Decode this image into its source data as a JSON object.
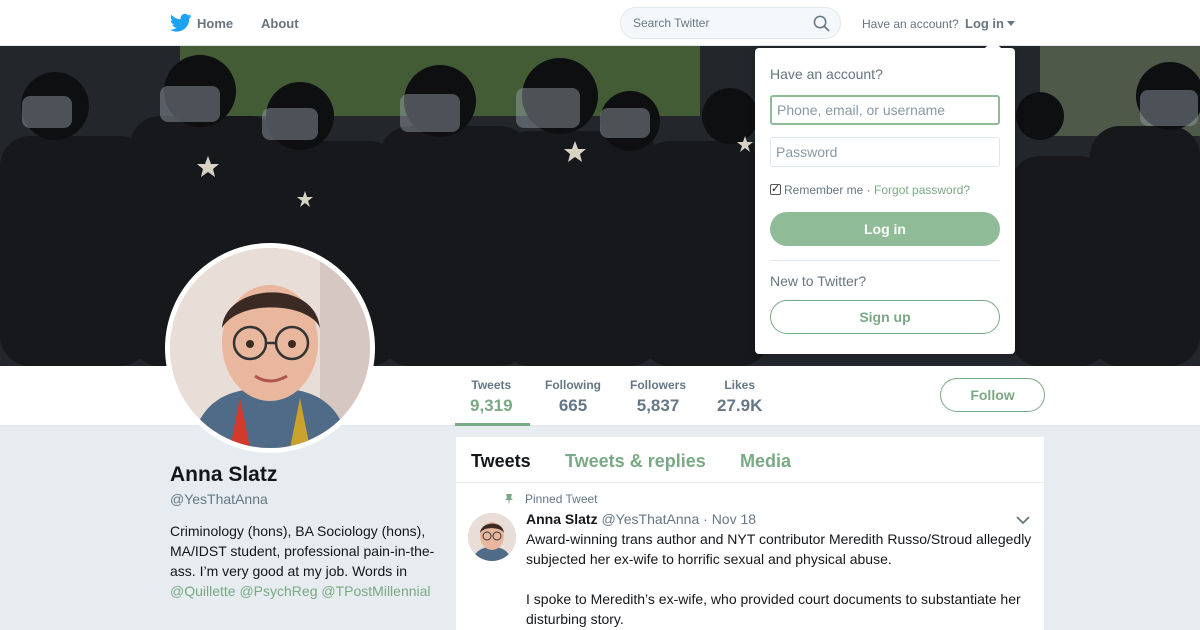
{
  "nav": {
    "home_label": "Home",
    "about_label": "About",
    "search_placeholder": "Search Twitter",
    "have_account": "Have an account?",
    "login_label": "Log in"
  },
  "profile": {
    "name": "Anna Slatz",
    "handle": "@YesThatAnna",
    "bio_text": "Criminology (hons), BA Sociology (hons), MA/IDST student, professional pain-in-the-ass. I’m very good at my job. Words in ",
    "bio_links": [
      "@Quillette",
      "@PsychReg",
      "@TPostMillennial"
    ],
    "follow_label": "Follow"
  },
  "stats": [
    {
      "label": "Tweets",
      "value": "9,319",
      "active": true
    },
    {
      "label": "Following",
      "value": "665"
    },
    {
      "label": "Followers",
      "value": "5,837"
    },
    {
      "label": "Likes",
      "value": "27.9K"
    }
  ],
  "timeline": {
    "tabs": [
      "Tweets",
      "Tweets & replies",
      "Media"
    ],
    "pinned_label": "Pinned Tweet",
    "tweet": {
      "name": "Anna Slatz",
      "handle": "@YesThatAnna",
      "date": "Nov 18",
      "text": "Award-winning trans author and NYT contributor Meredith Russo/Stroud allegedly subjected her ex-wife to horrific sexual and physical abuse.\n\nI spoke to Meredith’s ex-wife, who provided court documents to substantiate her disturbing story."
    }
  },
  "login_dropdown": {
    "title": "Have an account?",
    "username_placeholder": "Phone, email, or username",
    "password_placeholder": "Password",
    "remember_me": "Remember me",
    "separator": " · ",
    "forgot_password": "Forgot password?",
    "login_button": "Log in",
    "new_to_twitter": "New to Twitter?",
    "signup_button": "Sign up"
  },
  "colors": {
    "accent": "#7aa985",
    "login_button_bg": "#8fbb96",
    "brand_bird": "#1da1f2"
  },
  "icons": [
    "twitter-bird-icon",
    "search-icon",
    "caret-down-icon",
    "pin-icon",
    "chevron-down-icon",
    "checkbox-icon"
  ]
}
